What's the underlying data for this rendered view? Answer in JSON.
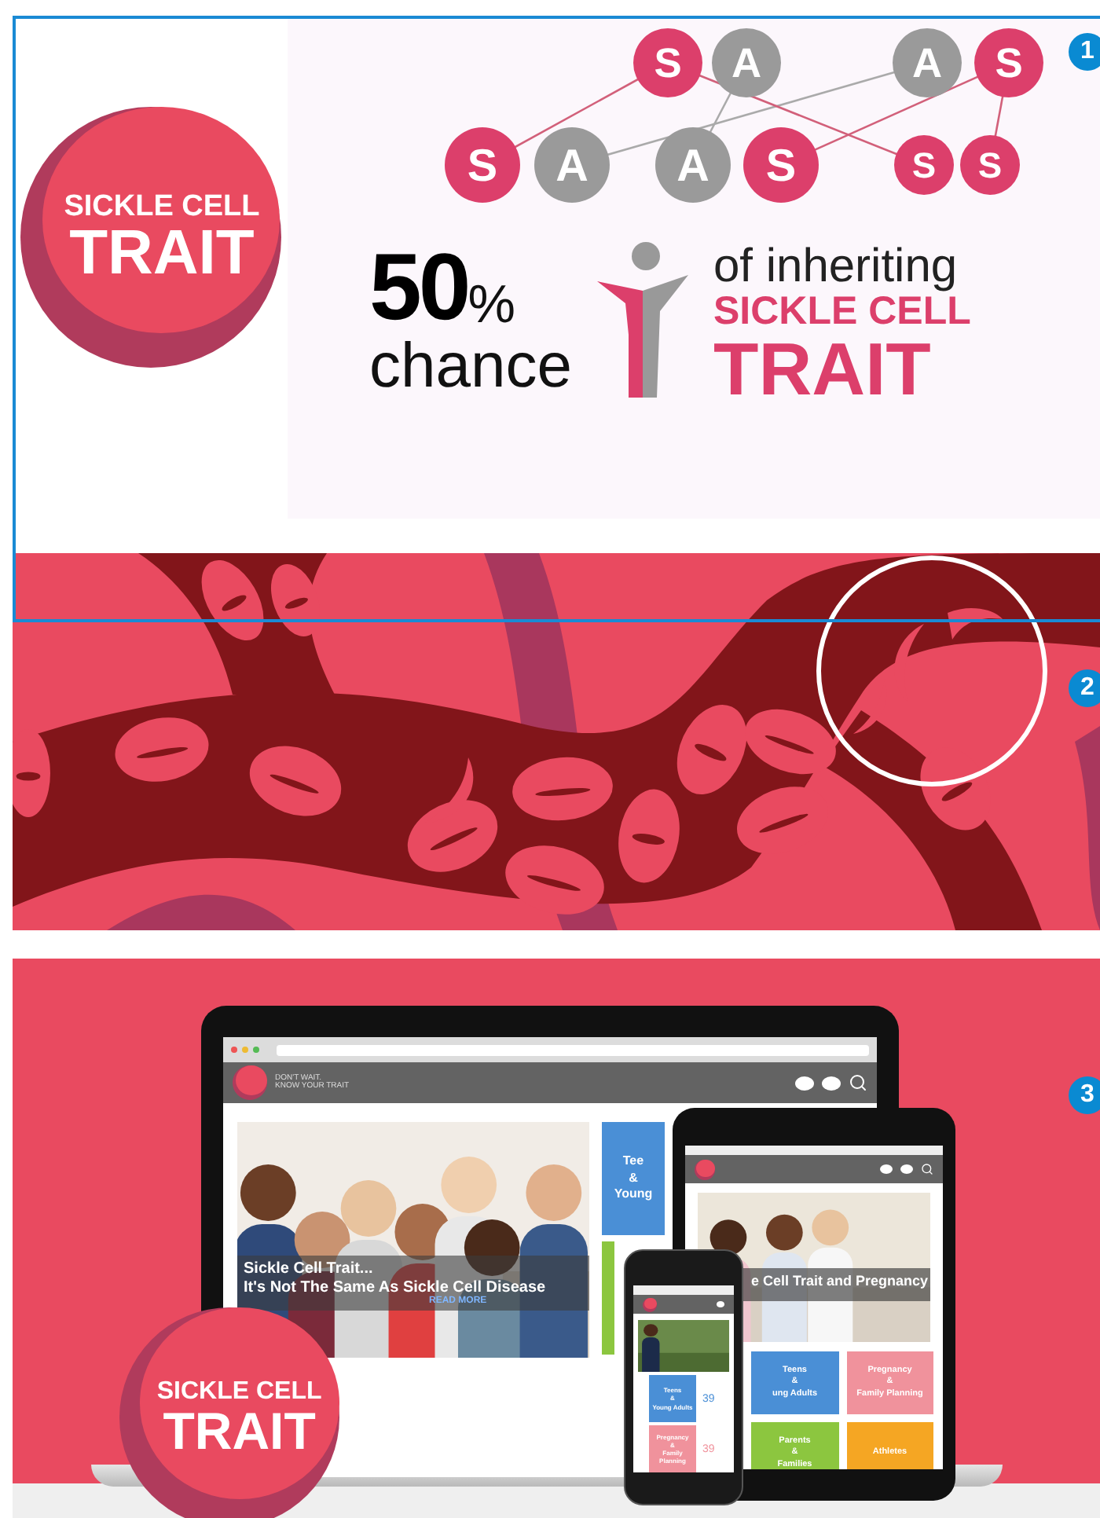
{
  "panels": [
    {
      "kind": "infographic",
      "marker": "1",
      "selected": true,
      "logo": {
        "line_1": "SICKLE CELL",
        "line_2": "TRAIT"
      },
      "alleles": [
        {
          "letter": "S",
          "color": "#dc3f6b"
        },
        {
          "letter": "A",
          "color": "#9a9a9a"
        },
        {
          "letter": "A",
          "color": "#9a9a9a"
        },
        {
          "letter": "S",
          "color": "#dc3f6b"
        },
        {
          "letter": "S",
          "color": "#dc3f6b"
        },
        {
          "letter": "A",
          "color": "#9a9a9a"
        },
        {
          "letter": "A",
          "color": "#9a9a9a"
        },
        {
          "letter": "S",
          "color": "#dc3f6b"
        },
        {
          "letter": "S",
          "color": "#dc3f6b"
        },
        {
          "letter": "S",
          "color": "#dc3f6b"
        }
      ],
      "stat": {
        "number": "50",
        "unit": "%",
        "word": "chance",
        "lead": "of inheriting",
        "line_1": "SICKLE CELL",
        "line_2": "TRAIT"
      }
    },
    {
      "kind": "illustration",
      "marker": "2",
      "selected": false
    },
    {
      "kind": "mockup",
      "marker": "3",
      "selected": false,
      "laptop": {
        "tagline": "DON'T WAIT.\nKNOW YOUR TRAIT",
        "caption_1": "Sickle Cell Trait...",
        "caption_2": "It's Not The Same As Sickle Cell Disease",
        "link": "READ MORE",
        "tiles": [
          {
            "lines": "Tee\n&\nYoung",
            "color": "#4a8fd6"
          },
          {
            "color": "#8cc63f"
          }
        ]
      },
      "tablet": {
        "caption": "e Cell Trait and Pregnancy",
        "tiles": [
          {
            "lines": "Teens\n&\nung Adults",
            "color": "#4a8fd6"
          },
          {
            "lines": "Pregnancy\n&\nFamily Planning",
            "color": "#f0929c"
          },
          {
            "lines": "Parents\n&\nFamilies",
            "color": "#8cc63f"
          },
          {
            "lines": "Athletes",
            "color": "#f5a623"
          }
        ]
      },
      "phone": {
        "tiles": [
          {
            "lines": "Teens\n&\nYoung Adults",
            "color": "#4a8fd6",
            "count": "39"
          },
          {
            "lines": "Pregnancy\n&\nFamily Planning",
            "color": "#f0929c",
            "count": "39"
          }
        ]
      },
      "overlay_logo": {
        "line_1": "SICKLE CELL",
        "line_2": "TRAIT"
      }
    }
  ]
}
